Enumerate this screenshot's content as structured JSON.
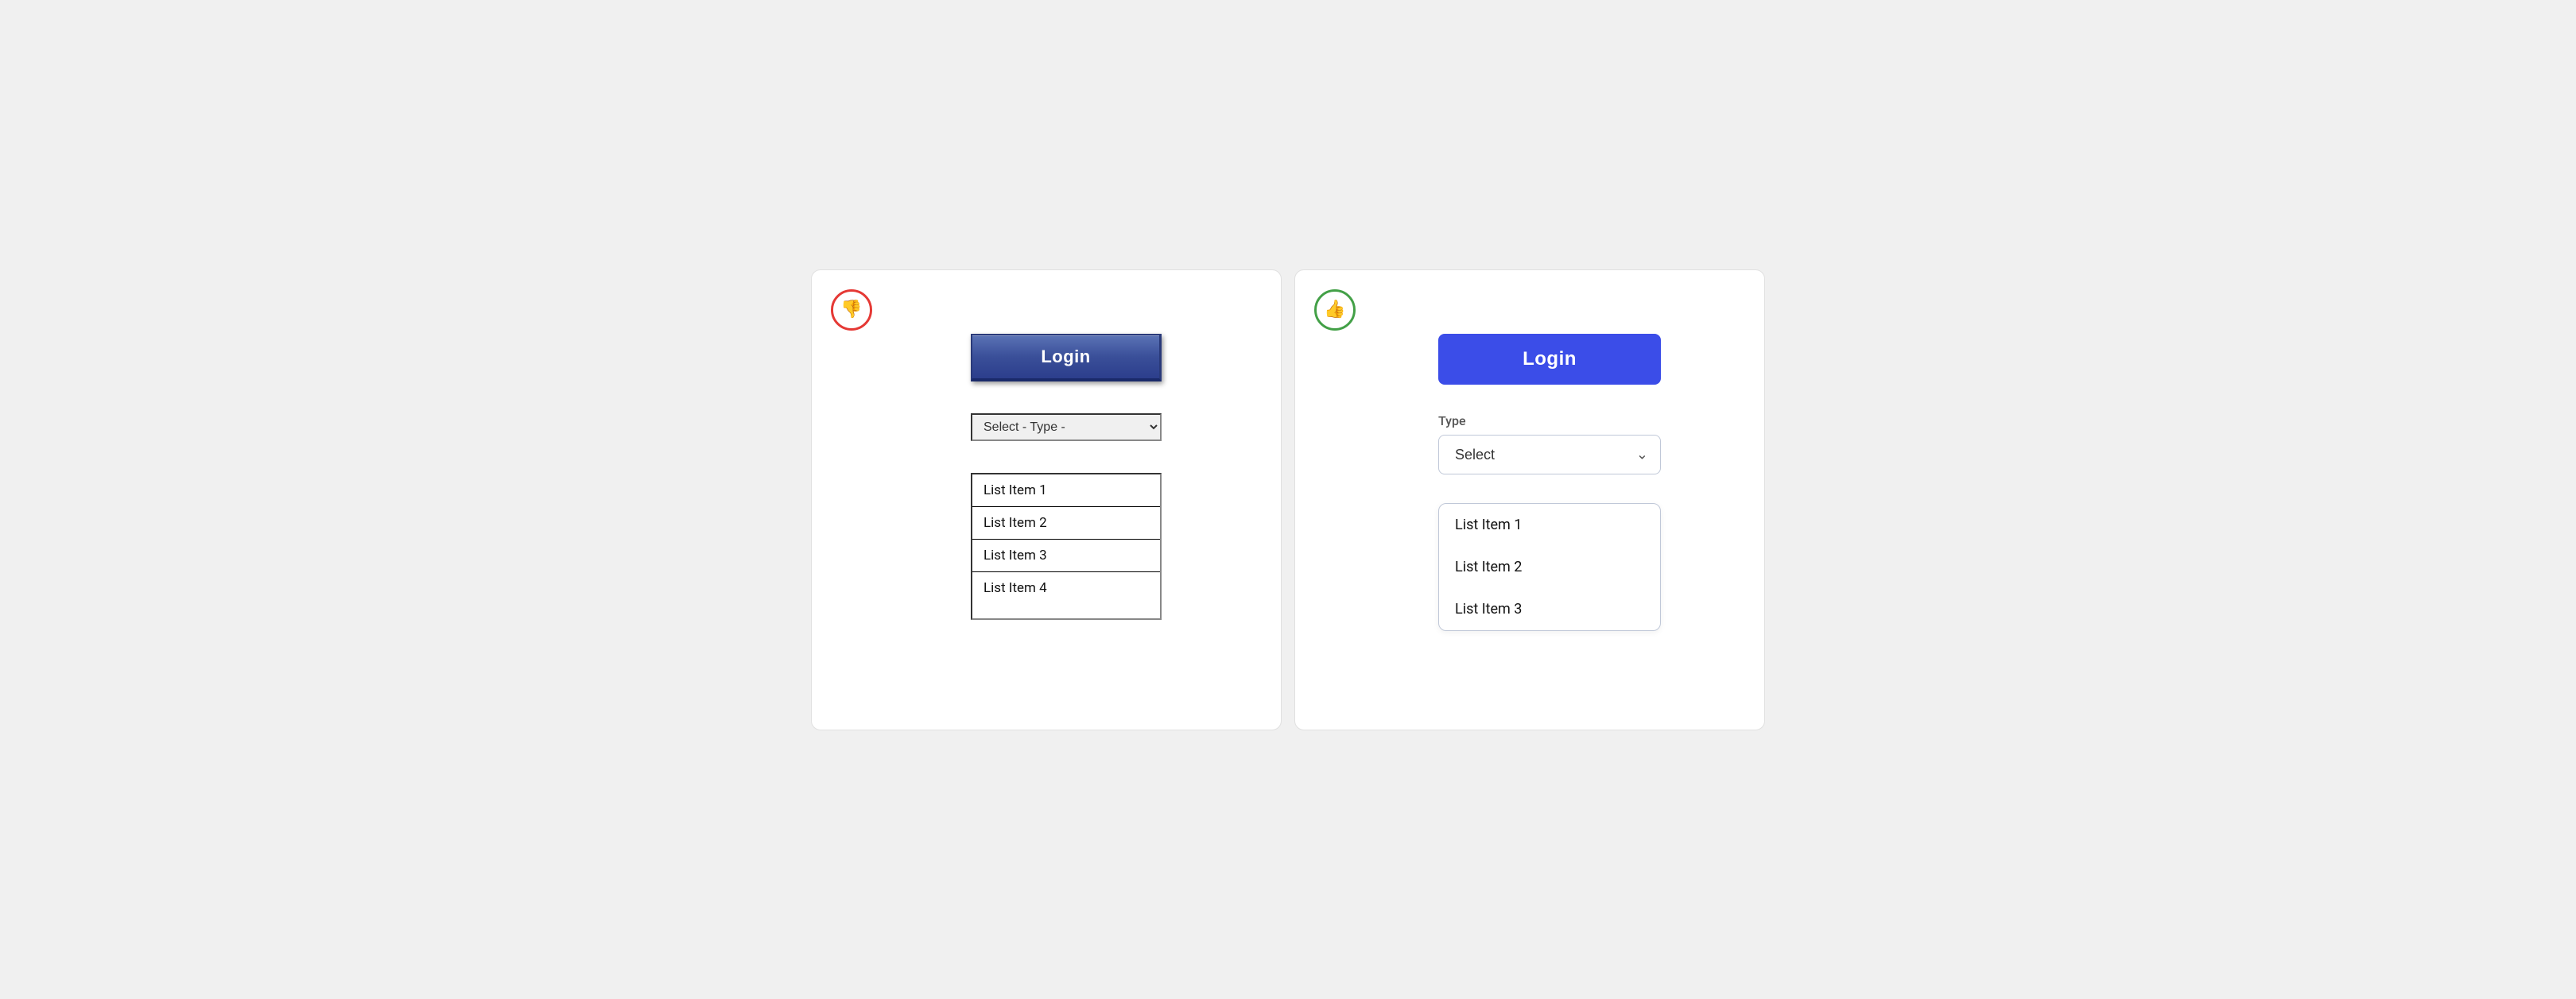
{
  "left_panel": {
    "badge_type": "bad",
    "badge_icon": "👎",
    "login_button": "Login",
    "select_placeholder": "Select - Type -",
    "list_items": [
      "List Item 1",
      "List Item 2",
      "List Item 3",
      "List Item 4"
    ]
  },
  "right_panel": {
    "badge_type": "good",
    "badge_icon": "👍",
    "login_button": "Login",
    "type_label": "Type",
    "select_placeholder": "Select",
    "select_chevron": "⌄",
    "list_items": [
      "List Item 1",
      "List Item 2",
      "List Item 3"
    ]
  },
  "colors": {
    "bad_badge": "#e53935",
    "good_badge": "#43a047",
    "login_old": "#3a4f99",
    "login_new": "#3b4de8"
  }
}
